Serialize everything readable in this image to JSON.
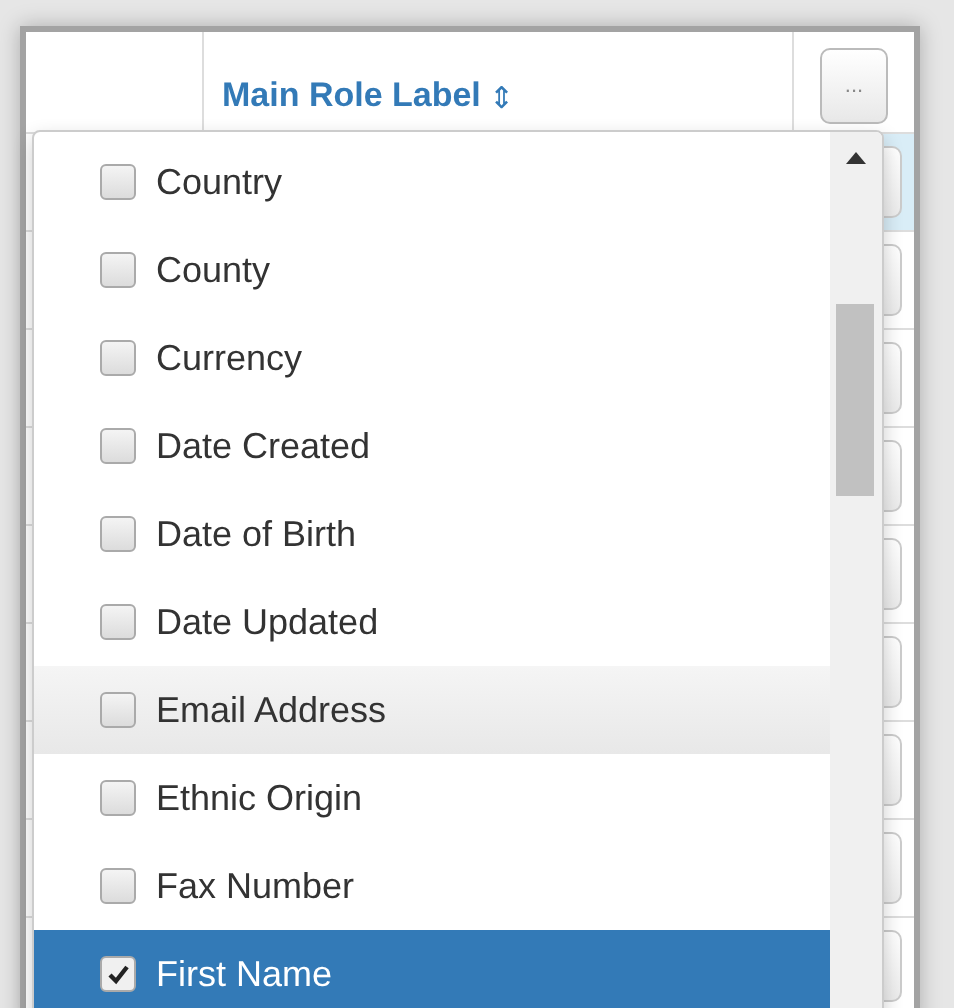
{
  "header": {
    "column_label": "Main Role Label",
    "sort_icon": "⇕",
    "menu_button": "..."
  },
  "background_rows": [
    {
      "selected": true
    },
    {
      "selected": false
    },
    {
      "selected": false
    },
    {
      "selected": false
    },
    {
      "selected": false
    },
    {
      "selected": false
    },
    {
      "selected": false
    },
    {
      "selected": false
    },
    {
      "selected": false
    }
  ],
  "dropdown": {
    "items": [
      {
        "label": "Country",
        "checked": false,
        "hovered": false,
        "selected": false
      },
      {
        "label": "County",
        "checked": false,
        "hovered": false,
        "selected": false
      },
      {
        "label": "Currency",
        "checked": false,
        "hovered": false,
        "selected": false
      },
      {
        "label": "Date Created",
        "checked": false,
        "hovered": false,
        "selected": false
      },
      {
        "label": "Date of Birth",
        "checked": false,
        "hovered": false,
        "selected": false
      },
      {
        "label": "Date Updated",
        "checked": false,
        "hovered": false,
        "selected": false
      },
      {
        "label": "Email Address",
        "checked": false,
        "hovered": true,
        "selected": false
      },
      {
        "label": "Ethnic Origin",
        "checked": false,
        "hovered": false,
        "selected": false
      },
      {
        "label": "Fax Number",
        "checked": false,
        "hovered": false,
        "selected": false
      },
      {
        "label": "First Name",
        "checked": true,
        "hovered": false,
        "selected": true
      }
    ]
  }
}
